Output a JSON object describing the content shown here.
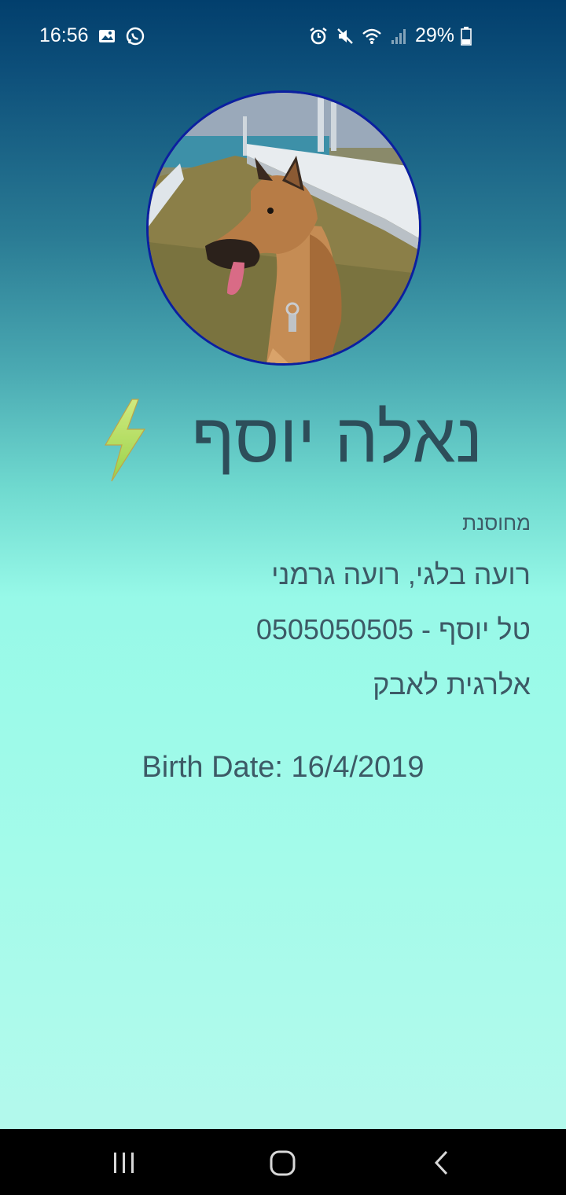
{
  "status_bar": {
    "time": "16:56",
    "battery": "29%",
    "icons_left": [
      "gallery-icon",
      "whatsapp-icon"
    ],
    "icons_right": [
      "alarm-icon",
      "mute-icon",
      "wifi-icon",
      "signal-icon",
      "battery-icon"
    ]
  },
  "profile": {
    "name": "נאלה יוסף",
    "name_icon": "lightning-bolt-icon",
    "neutered": "מחוסנת",
    "breed": "רועה בלגי, רועה גרמני",
    "owner": "טל יוסף - 0505050505",
    "allergy": "אלרגית לאבק",
    "birth_date": "Birth Date: 16/4/2019"
  },
  "nav_bar": {
    "buttons": [
      "recent-apps",
      "home",
      "back"
    ]
  },
  "colors": {
    "gradient_top": "#023f6d",
    "gradient_mid": "#6fd9cf",
    "gradient_bottom": "#b3f9ec",
    "text": "#3d5a66",
    "avatar_border": "#0b1fa0"
  }
}
